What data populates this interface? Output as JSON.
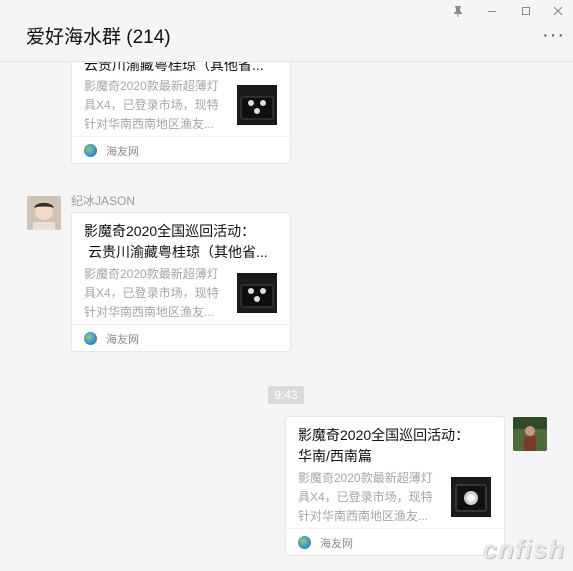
{
  "window": {
    "title": "爱好海水群 (214)",
    "controls": [
      "pin-icon",
      "minimize-icon",
      "maximize-icon",
      "close-icon"
    ],
    "more": "···"
  },
  "messages": [
    {
      "title_lines": [
        "云贵川渝藏粤桂琼（其他省..."
      ],
      "desc_lines": [
        "影魔奇2020款最新超薄灯",
        "具X4，已登录市场，现特",
        "针对华南西南地区渔友..."
      ],
      "source": "海友网"
    },
    {
      "sender": "纪冰JASON",
      "title_lines": [
        "影魔奇2020全国巡回活动：",
        "云贵川渝藏粤桂琼（其他省..."
      ],
      "desc_lines": [
        "影魔奇2020款最新超薄灯",
        "具X4，已登录市场，现特",
        "针对华南西南地区渔友..."
      ],
      "source": "海友网"
    },
    {
      "title_lines": [
        "影魔奇2020全国巡回活动：",
        "华南/西南篇"
      ],
      "desc_lines": [
        "影魔奇2020款最新超薄灯",
        "具X4，已登录市场，现特",
        "针对华南西南地区渔友..."
      ],
      "source": "海友网"
    }
  ],
  "timestamp": "9:43",
  "watermark": "cnfish"
}
